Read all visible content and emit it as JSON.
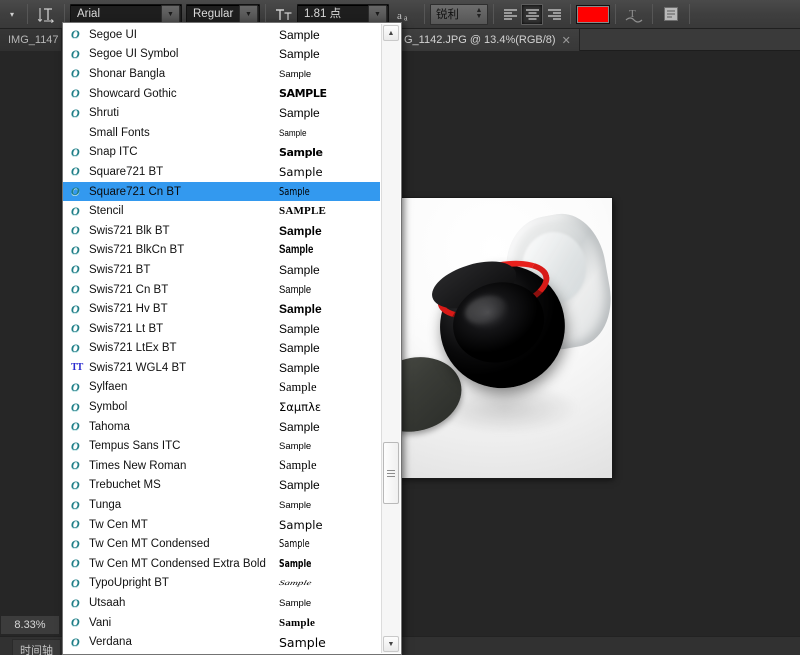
{
  "optionsbar": {
    "preset_arrow": "▾",
    "orientation_icon": "text-orientation-icon",
    "font_family_value": "Arial",
    "font_style_value": "Regular",
    "font_size_value": "1.81 点",
    "size_icon_label": "TT",
    "antialias_icon_label": "aa",
    "antialias_value": "锐利",
    "align_left_label": "≡",
    "align_center_label": "≡",
    "align_right_label": "≡",
    "color_swatch": "#ff0000",
    "warp_icon": "warp-text-icon",
    "panel_icon": "character-panel-icon",
    "dropdown_arrow": "▼"
  },
  "tabs": [
    {
      "title": "IMG_1147",
      "active": false,
      "close": ""
    },
    {
      "title": "G_1142.JPG @ 13.4%(RGB/8)",
      "active": true,
      "close": "✕"
    }
  ],
  "statusbar": {
    "zoom": "8.33%",
    "doc_icon": "document-info-icon",
    "timeline_label": "时间轴"
  },
  "canvas": {
    "alt": "product photo: black jar lid with red ring, glass jar and dark disc on white background"
  },
  "font_menu": {
    "scroll_up": "▲",
    "scroll_down": "▼",
    "selected_index": 8,
    "items": [
      {
        "icon": "O",
        "icon_type": "otf",
        "name": "Segoe UI",
        "sample": "Sample",
        "style": "s-norm"
      },
      {
        "icon": "O",
        "icon_type": "otf",
        "name": "Segoe UI Symbol",
        "sample": "Sample",
        "style": "s-norm"
      },
      {
        "icon": "O",
        "icon_type": "otf",
        "name": "Shonar Bangla",
        "sample": "Sample",
        "style": "s-small"
      },
      {
        "icon": "O",
        "icon_type": "otf",
        "name": "Showcard Gothic",
        "sample": "SAMPLE",
        "style": "s-blkwide"
      },
      {
        "icon": "O",
        "icon_type": "otf",
        "name": "Shruti",
        "sample": "Sample",
        "style": "s-norm"
      },
      {
        "icon": "",
        "icon_type": "none",
        "name": "Small Fonts",
        "sample": "Sample",
        "style": "s-tiny"
      },
      {
        "icon": "O",
        "icon_type": "otf",
        "name": "Snap ITC",
        "sample": "Sample",
        "style": "s-blkwide"
      },
      {
        "icon": "O",
        "icon_type": "otf",
        "name": "Square721 BT",
        "sample": "Sample",
        "style": "s-geo"
      },
      {
        "icon": "O",
        "icon_type": "otf",
        "name": "Square721 Cn BT",
        "sample": "Sample",
        "style": "s-geocond"
      },
      {
        "icon": "O",
        "icon_type": "otf",
        "name": "Stencil",
        "sample": "SAMPLE",
        "style": "s-serifcaps"
      },
      {
        "icon": "O",
        "icon_type": "otf",
        "name": "Swis721 Blk BT",
        "sample": "Sample",
        "style": "s-bold"
      },
      {
        "icon": "O",
        "icon_type": "otf",
        "name": "Swis721 BlkCn BT",
        "sample": "Sample",
        "style": "s-boldcond"
      },
      {
        "icon": "O",
        "icon_type": "otf",
        "name": "Swis721 BT",
        "sample": "Sample",
        "style": "s-norm"
      },
      {
        "icon": "O",
        "icon_type": "otf",
        "name": "Swis721 Cn BT",
        "sample": "Sample",
        "style": "s-cond"
      },
      {
        "icon": "O",
        "icon_type": "otf",
        "name": "Swis721 Hv BT",
        "sample": "Sample",
        "style": "s-bold"
      },
      {
        "icon": "O",
        "icon_type": "otf",
        "name": "Swis721 Lt BT",
        "sample": "Sample",
        "style": "s-norm"
      },
      {
        "icon": "O",
        "icon_type": "otf",
        "name": "Swis721 LtEx BT",
        "sample": "Sample",
        "style": "s-norm"
      },
      {
        "icon": "TT",
        "icon_type": "ttf",
        "name": "Swis721 WGL4 BT",
        "sample": "Sample",
        "style": "s-norm"
      },
      {
        "icon": "O",
        "icon_type": "otf",
        "name": "Sylfaen",
        "sample": "Sample",
        "style": "s-serif"
      },
      {
        "icon": "O",
        "icon_type": "otf",
        "name": "Symbol",
        "sample": "Σαμπλε",
        "style": "s-greek"
      },
      {
        "icon": "O",
        "icon_type": "otf",
        "name": "Tahoma",
        "sample": "Sample",
        "style": "s-norm"
      },
      {
        "icon": "O",
        "icon_type": "otf",
        "name": "Tempus Sans ITC",
        "sample": "Sample",
        "style": "s-small"
      },
      {
        "icon": "O",
        "icon_type": "otf",
        "name": "Times New Roman",
        "sample": "Sample",
        "style": "s-serif"
      },
      {
        "icon": "O",
        "icon_type": "otf",
        "name": "Trebuchet MS",
        "sample": "Sample",
        "style": "s-norm"
      },
      {
        "icon": "O",
        "icon_type": "otf",
        "name": "Tunga",
        "sample": "Sample",
        "style": "s-small"
      },
      {
        "icon": "O",
        "icon_type": "otf",
        "name": "Tw Cen MT",
        "sample": "Sample",
        "style": "s-geo"
      },
      {
        "icon": "O",
        "icon_type": "otf",
        "name": "Tw Cen MT Condensed",
        "sample": "Sample",
        "style": "s-geocond"
      },
      {
        "icon": "O",
        "icon_type": "otf",
        "name": "Tw Cen MT Condensed Extra Bold",
        "sample": "Sample",
        "style": "s-geocondb"
      },
      {
        "icon": "O",
        "icon_type": "otf",
        "name": "TypoUpright BT",
        "sample": "Sample",
        "style": "s-script"
      },
      {
        "icon": "O",
        "icon_type": "otf",
        "name": "Utsaah",
        "sample": "Sample",
        "style": "s-small"
      },
      {
        "icon": "O",
        "icon_type": "otf",
        "name": "Vani",
        "sample": "Sample",
        "style": "s-serifcaps"
      },
      {
        "icon": "O",
        "icon_type": "otf",
        "name": "Verdana",
        "sample": "Sample",
        "style": "s-verdana"
      }
    ]
  }
}
